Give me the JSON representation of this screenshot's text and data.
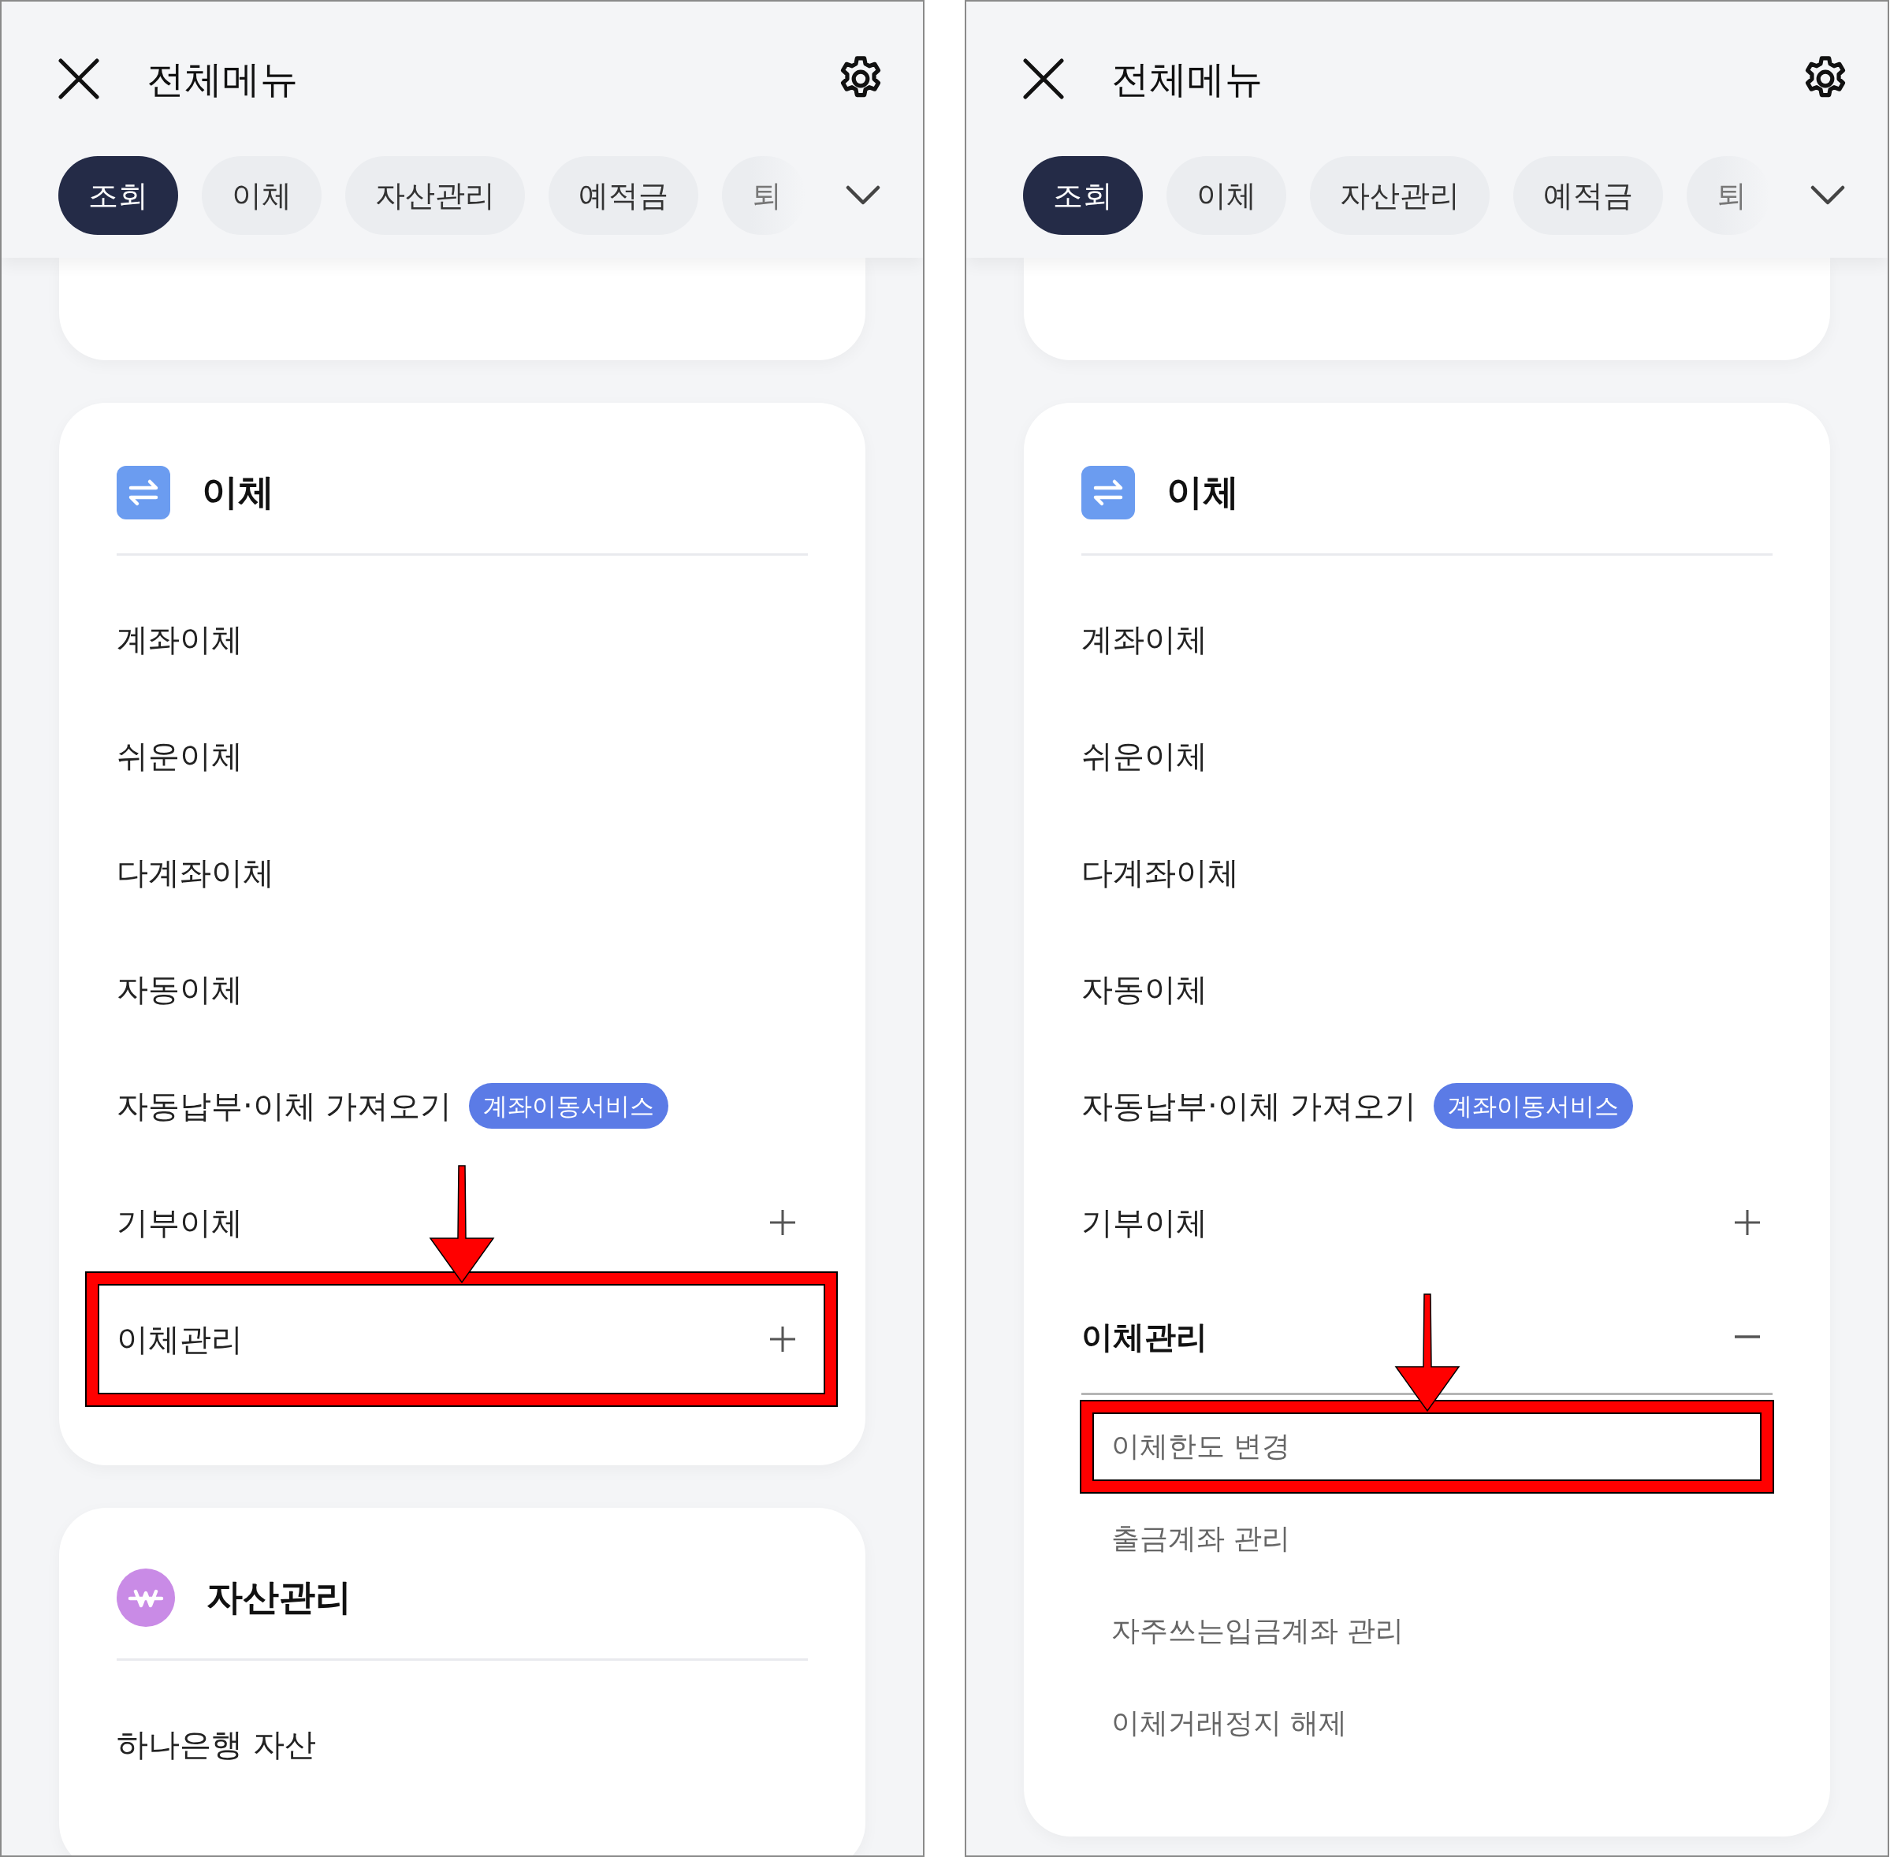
{
  "panels": [
    {
      "title": "전체메뉴",
      "tabs": [
        {
          "label": "조회",
          "selected": true
        },
        {
          "label": "이체",
          "selected": false
        },
        {
          "label": "자산관리",
          "selected": false
        },
        {
          "label": "예적금",
          "selected": false
        },
        {
          "label": "퇴",
          "selected": false
        }
      ],
      "sections": [
        {
          "kind": "blank"
        },
        {
          "kind": "transfer",
          "color": "#6b9cf0",
          "title": "이체",
          "items": [
            {
              "label": "계좌이체",
              "highlighted": false
            },
            {
              "label": "쉬운이체",
              "highlighted": false
            },
            {
              "label": "다계좌이체",
              "highlighted": false
            },
            {
              "label": "자동이체",
              "highlighted": false
            },
            {
              "label": "자동납부·이체 가져오기",
              "badge": "계좌이동서비스",
              "highlighted": false
            },
            {
              "label": "기부이체",
              "expanded": false,
              "highlighted": false
            },
            {
              "label": "이체관리",
              "expanded": false,
              "highlighted": true
            }
          ]
        },
        {
          "kind": "assets",
          "color": "#c98be6",
          "title": "자산관리",
          "items": [
            {
              "label": "하나은행 자산",
              "highlighted": false
            }
          ]
        }
      ]
    },
    {
      "title": "전체메뉴",
      "tabs": [
        {
          "label": "조회",
          "selected": true
        },
        {
          "label": "이체",
          "selected": false
        },
        {
          "label": "자산관리",
          "selected": false
        },
        {
          "label": "예적금",
          "selected": false
        },
        {
          "label": "퇴",
          "selected": false
        }
      ],
      "sections": [
        {
          "kind": "blank"
        },
        {
          "kind": "transfer",
          "color": "#6b9cf0",
          "title": "이체",
          "items": [
            {
              "label": "계좌이체",
              "highlighted": false
            },
            {
              "label": "쉬운이체",
              "highlighted": false
            },
            {
              "label": "다계좌이체",
              "highlighted": false
            },
            {
              "label": "자동이체",
              "highlighted": false
            },
            {
              "label": "자동납부·이체 가져오기",
              "badge": "계좌이동서비스",
              "highlighted": false
            },
            {
              "label": "기부이체",
              "expanded": false,
              "highlighted": false
            },
            {
              "label": "이체관리",
              "expanded": true,
              "highlighted": false,
              "children": [
                {
                  "label": "이체한도 변경",
                  "highlighted": true
                },
                {
                  "label": "출금계좌 관리",
                  "highlighted": false
                },
                {
                  "label": "자주쓰는입금계좌 관리",
                  "highlighted": false
                },
                {
                  "label": "이체거래정지 해제",
                  "highlighted": false
                }
              ]
            }
          ]
        }
      ]
    }
  ]
}
